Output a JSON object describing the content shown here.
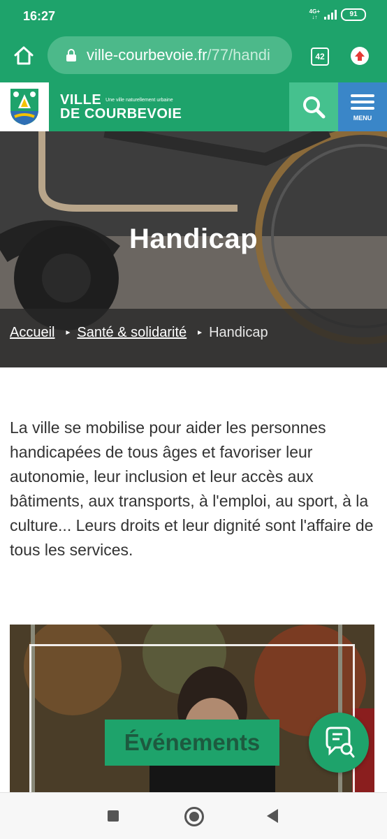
{
  "status_bar": {
    "time": "16:27",
    "network": "4G+",
    "battery": "91"
  },
  "browser": {
    "url_host": "ville-courbevoie.fr",
    "url_path": "/77/handi",
    "tab_count": "42"
  },
  "site": {
    "title_line1": "VILLE",
    "tagline": "Une ville naturellement urbaine",
    "title_line2": "DE COURBEVOIE",
    "menu_label": "MENU"
  },
  "hero": {
    "title": "Handicap",
    "breadcrumb": [
      {
        "label": "Accueil"
      },
      {
        "label": "Santé & solidarité"
      },
      {
        "label": "Handicap"
      }
    ]
  },
  "intro_text": "La ville se mobilise pour aider les personnes handicapées de tous âges et favoriser leur autonomie, leur inclusion et leur accès aux bâtiments, aux transports, à l'emploi, au sport, à la culture... Leurs droits et leur dignité sont l'affaire de tous les services.",
  "card": {
    "label": "Événements"
  },
  "colors": {
    "brand_green": "#1ea36b",
    "menu_blue": "#3a86c8",
    "search_green": "#45c18e"
  }
}
